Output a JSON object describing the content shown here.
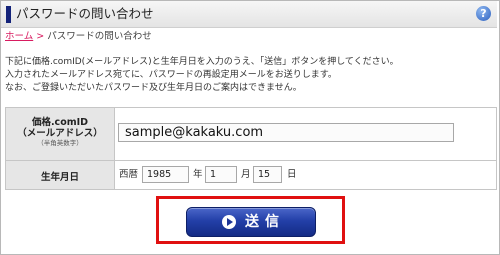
{
  "header": {
    "title": "パスワードの問い合わせ",
    "help_icon_glyph": "?"
  },
  "breadcrumb": {
    "home": "ホーム",
    "separator": ">",
    "current": "パスワードの問い合わせ"
  },
  "intro": {
    "lines": [
      "下記に価格.comID(メールアドレス)と生年月日を入力のうえ、「送信」ボタンを押してください。",
      "入力されたメールアドレス宛てに、パスワードの再設定用メールをお送りします。",
      "なお、ご登録いただいたパスワード及び生年月日のご案内はできません。"
    ]
  },
  "form": {
    "id_label_line1": "価格.comID",
    "id_label_line2": "（メールアドレス）",
    "id_label_note": "（半角英数字）",
    "email_value": "sample@kakaku.com",
    "dob_label": "生年月日",
    "era": "西暦",
    "year_value": "1985",
    "year_unit": "年",
    "month_value": "1",
    "month_unit": "月",
    "day_value": "15",
    "day_unit": "日"
  },
  "submit": {
    "label": "送信",
    "icon": "play-circle-icon"
  },
  "colors": {
    "accent": "#14237a",
    "link": "#d81b60",
    "button": "#1f3a9e",
    "highlight": "#e01010"
  }
}
